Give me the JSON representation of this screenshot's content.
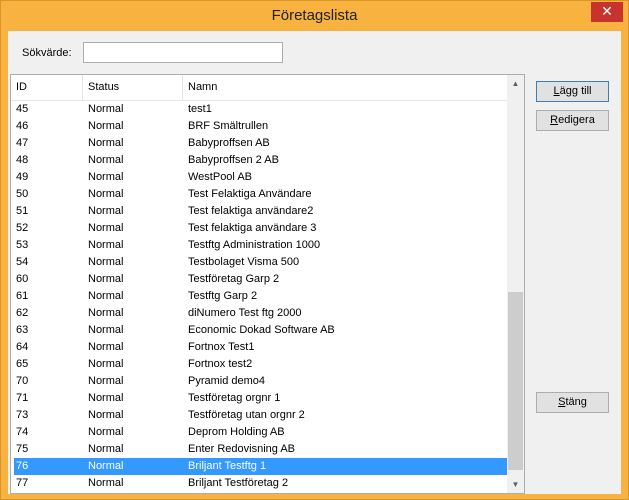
{
  "window": {
    "title": "Företagslista",
    "close_glyph": "✕"
  },
  "search": {
    "label": "Sökvärde:",
    "value": ""
  },
  "table": {
    "columns": [
      "ID",
      "Status",
      "Namn"
    ],
    "rows": [
      {
        "id": "45",
        "status": "Normal",
        "name": "test1"
      },
      {
        "id": "46",
        "status": "Normal",
        "name": "BRF Smältrullen"
      },
      {
        "id": "47",
        "status": "Normal",
        "name": "Babyproffsen AB"
      },
      {
        "id": "48",
        "status": "Normal",
        "name": "Babyproffsen 2 AB"
      },
      {
        "id": "49",
        "status": "Normal",
        "name": "WestPool AB"
      },
      {
        "id": "50",
        "status": "Normal",
        "name": "Test Felaktiga Användare"
      },
      {
        "id": "51",
        "status": "Normal",
        "name": "Test felaktiga användare2"
      },
      {
        "id": "52",
        "status": "Normal",
        "name": "Test felaktiga användare 3"
      },
      {
        "id": "53",
        "status": "Normal",
        "name": "Testftg Administration 1000"
      },
      {
        "id": "54",
        "status": "Normal",
        "name": "Testbolaget Visma 500"
      },
      {
        "id": "60",
        "status": "Normal",
        "name": "Testföretag Garp 2"
      },
      {
        "id": "61",
        "status": "Normal",
        "name": "Testftg Garp 2"
      },
      {
        "id": "62",
        "status": "Normal",
        "name": "diNumero Test ftg 2000"
      },
      {
        "id": "63",
        "status": "Normal",
        "name": "Economic Dokad Software AB"
      },
      {
        "id": "64",
        "status": "Normal",
        "name": "Fortnox Test1"
      },
      {
        "id": "65",
        "status": "Normal",
        "name": "Fortnox test2"
      },
      {
        "id": "70",
        "status": "Normal",
        "name": "Pyramid demo4"
      },
      {
        "id": "71",
        "status": "Normal",
        "name": "Testföretag orgnr 1"
      },
      {
        "id": "73",
        "status": "Normal",
        "name": "Testföretag utan orgnr 2"
      },
      {
        "id": "74",
        "status": "Normal",
        "name": "Deprom Holding AB"
      },
      {
        "id": "75",
        "status": "Normal",
        "name": "Enter Redovisning AB"
      },
      {
        "id": "76",
        "status": "Normal",
        "name": "Briljant Testftg 1",
        "selected": true
      },
      {
        "id": "77",
        "status": "Normal",
        "name": "Briljant Testföretag 2"
      }
    ]
  },
  "buttons": {
    "add_first": "L",
    "add_rest": "ägg till",
    "edit_first": "R",
    "edit_rest": "edigera",
    "close_first": "S",
    "close_rest": "täng"
  },
  "colors": {
    "frame": "#f7b23f",
    "selection": "#3399ff",
    "close": "#c7342d"
  }
}
